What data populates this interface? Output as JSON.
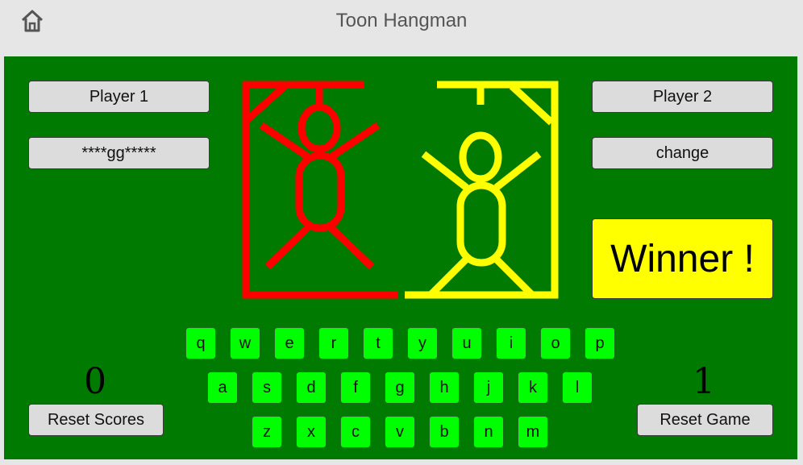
{
  "app": {
    "title": "Toon Hangman"
  },
  "icons": {
    "home": "home-icon"
  },
  "colors": {
    "board": "#007a00",
    "player1": "#ff0000",
    "player2": "#ffff00",
    "key": "#00ff00",
    "winner": "#ffff00"
  },
  "player1": {
    "name": "Player 1",
    "word": "****gg*****",
    "score": "0"
  },
  "player2": {
    "name": "Player 2",
    "word": "change",
    "score": "1",
    "status": "Winner !"
  },
  "buttons": {
    "reset_scores": "Reset Scores",
    "reset_game": "Reset Game"
  },
  "keyboard": {
    "rows": [
      [
        "q",
        "w",
        "e",
        "r",
        "t",
        "y",
        "u",
        "i",
        "o",
        "p"
      ],
      [
        "a",
        "s",
        "d",
        "f",
        "g",
        "h",
        "j",
        "k",
        "l"
      ],
      [
        "z",
        "x",
        "c",
        "v",
        "b",
        "n",
        "m"
      ]
    ]
  }
}
